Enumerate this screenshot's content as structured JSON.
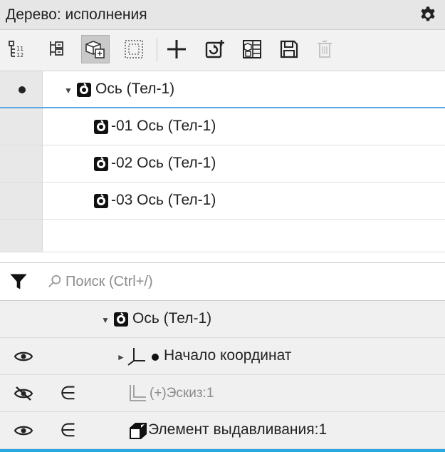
{
  "panel": {
    "title": "Дерево: исполнения",
    "settings_icon": "gear-icon"
  },
  "toolbar": {
    "buttons": [
      {
        "name": "structure-tree-icon",
        "active": false
      },
      {
        "name": "numbered-tree-icon",
        "active": false
      },
      {
        "name": "parts-3d-icon",
        "active": true
      },
      {
        "name": "dashed-selection-icon",
        "active": false
      },
      {
        "name": "add-icon",
        "active": false
      },
      {
        "name": "rebuild-icon",
        "active": false
      },
      {
        "name": "table-icon",
        "active": false
      },
      {
        "name": "save-icon",
        "active": false
      },
      {
        "name": "delete-icon",
        "active": false,
        "disabled": true
      }
    ]
  },
  "variants": {
    "items": [
      {
        "label": "Ось (Тел-1)",
        "current": true,
        "expanded": true
      },
      {
        "label": "-01 Ось (Тел-1)"
      },
      {
        "label": "-02 Ось (Тел-1)"
      },
      {
        "label": "-03 Ось (Тел-1)"
      }
    ]
  },
  "search": {
    "placeholder": "Поиск (Ctrl+/)",
    "value": ""
  },
  "model_tree": {
    "items": [
      {
        "label": "Ось (Тел-1)",
        "visibility": "",
        "belongs": false
      },
      {
        "label": "Начало координат",
        "visibility": "visible",
        "belongs": false
      },
      {
        "label": "(+)Эскиз:1",
        "visibility": "hidden",
        "belongs": true
      },
      {
        "label": "Элемент выдавливания:1",
        "visibility": "visible",
        "belongs": true
      }
    ]
  },
  "colors": {
    "accent": "#29a9e1",
    "selection_line": "#5aa8e0",
    "panel_bg": "#f0f0f0"
  }
}
